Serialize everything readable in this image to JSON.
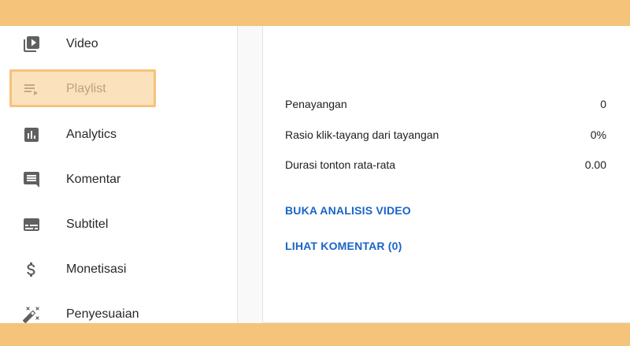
{
  "sidebar": {
    "items": [
      {
        "label": "Video",
        "icon": "video-library-icon"
      },
      {
        "label": "Playlist",
        "icon": "playlist-icon",
        "active": true
      },
      {
        "label": "Analytics",
        "icon": "analytics-icon"
      },
      {
        "label": "Komentar",
        "icon": "comment-icon"
      },
      {
        "label": "Subtitel",
        "icon": "subtitles-icon"
      },
      {
        "label": "Monetisasi",
        "icon": "dollar-icon"
      },
      {
        "label": "Penyesuaian",
        "icon": "magic-wand-icon"
      }
    ]
  },
  "metrics": [
    {
      "label": "Penayangan",
      "value": "0"
    },
    {
      "label": "Rasio klik-tayang dari tayangan",
      "value": "0%"
    },
    {
      "label": "Durasi tonton rata-rata",
      "value": "0.00"
    }
  ],
  "links": {
    "analytics": "BUKA ANALISIS VIDEO",
    "comments": "LIHAT KOMENTAR (0)"
  },
  "colors": {
    "frame": "#f6c37a",
    "highlight": "#fbe2bd",
    "link": "#1a64c7"
  }
}
